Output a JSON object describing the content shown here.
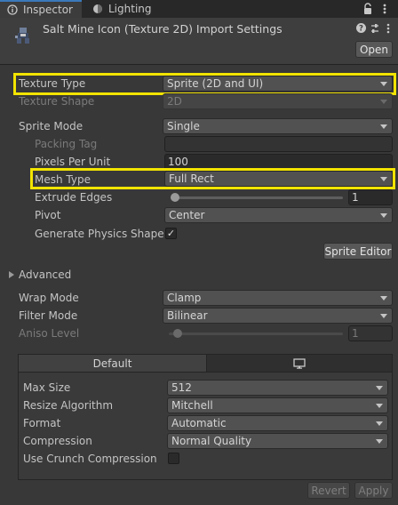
{
  "tabs": {
    "inspector": "Inspector",
    "lighting": "Lighting"
  },
  "header": {
    "title": "Salt Mine Icon (Texture 2D) Import Settings",
    "open_label": "Open"
  },
  "fields": {
    "texture_type": {
      "label": "Texture Type",
      "value": "Sprite (2D and UI)"
    },
    "texture_shape": {
      "label": "Texture Shape",
      "value": "2D"
    },
    "sprite_mode": {
      "label": "Sprite Mode",
      "value": "Single"
    },
    "packing_tag": {
      "label": "Packing Tag",
      "value": ""
    },
    "pixels_per_unit": {
      "label": "Pixels Per Unit",
      "value": "100"
    },
    "mesh_type": {
      "label": "Mesh Type",
      "value": "Full Rect"
    },
    "extrude_edges": {
      "label": "Extrude Edges",
      "value": "1",
      "level": 0.0
    },
    "pivot": {
      "label": "Pivot",
      "value": "Center"
    },
    "generate_physics_shape": {
      "label": "Generate Physics Shape",
      "checked": true,
      "mark": "✓"
    },
    "sprite_editor_label": "Sprite Editor",
    "advanced_label": "Advanced",
    "wrap_mode": {
      "label": "Wrap Mode",
      "value": "Clamp"
    },
    "filter_mode": {
      "label": "Filter Mode",
      "value": "Bilinear"
    },
    "aniso_level": {
      "label": "Aniso Level",
      "value": "1",
      "level": 0.0
    }
  },
  "platform": {
    "default_tab": "Default",
    "max_size": {
      "label": "Max Size",
      "value": "512"
    },
    "resize_algorithm": {
      "label": "Resize Algorithm",
      "value": "Mitchell"
    },
    "format": {
      "label": "Format",
      "value": "Automatic"
    },
    "compression": {
      "label": "Compression",
      "value": "Normal Quality"
    },
    "use_crunch": {
      "label": "Use Crunch Compression",
      "checked": false
    }
  },
  "footer": {
    "revert_label": "Revert",
    "apply_label": "Apply"
  },
  "colors": {
    "highlight": "#f2e400",
    "active_tab_accent": "#3a79bb",
    "background": "#383838"
  }
}
